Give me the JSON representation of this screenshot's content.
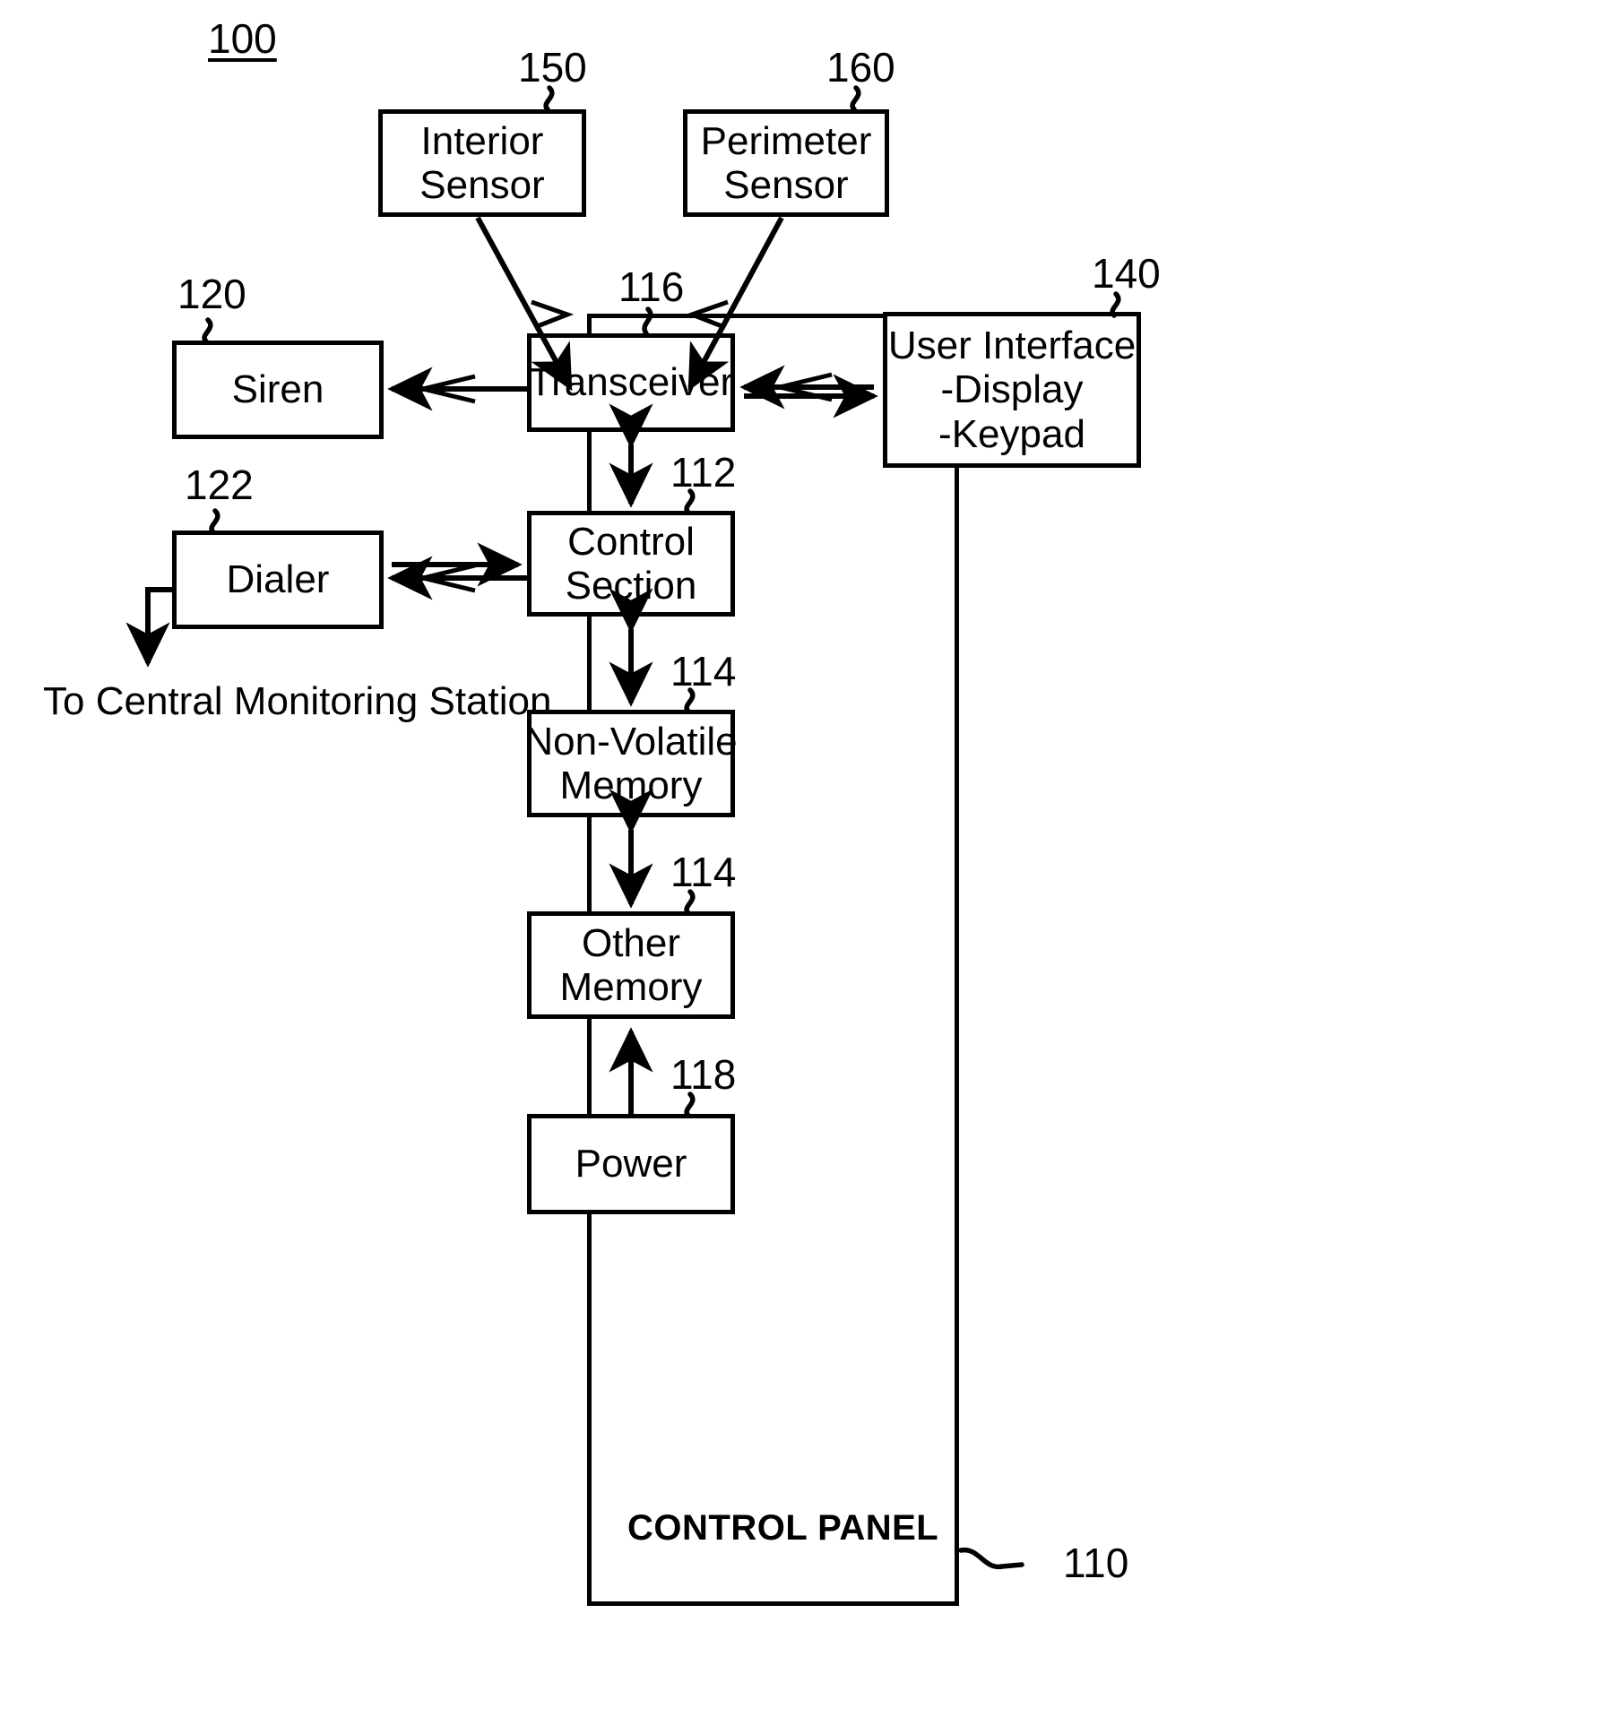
{
  "figure": {
    "number": "100"
  },
  "blocks": {
    "interior_sensor": {
      "lines": [
        "Interior",
        "Sensor"
      ],
      "ref": "150"
    },
    "perimeter_sensor": {
      "lines": [
        "Perimeter",
        "Sensor"
      ],
      "ref": "160"
    },
    "siren": {
      "lines": [
        "Siren"
      ],
      "ref": "120"
    },
    "dialer": {
      "lines": [
        "Dialer"
      ],
      "ref": "122"
    },
    "user_interface": {
      "lines": [
        "User Interface",
        "-Display",
        "-Keypad"
      ],
      "ref": "140"
    },
    "transceiver": {
      "lines": [
        "Transceiver"
      ],
      "ref": "116"
    },
    "control_section": {
      "lines": [
        "Control",
        "Section"
      ],
      "ref": "112"
    },
    "non_volatile_memory": {
      "lines": [
        "Non-Volatile",
        "Memory"
      ],
      "ref": "114"
    },
    "other_memory": {
      "lines": [
        "Other",
        "Memory"
      ],
      "ref": "114"
    },
    "power": {
      "lines": [
        "Power"
      ],
      "ref": "118"
    }
  },
  "control_panel": {
    "title": "CONTROL PANEL",
    "ref": "110"
  },
  "annotations": {
    "central_station": [
      "To",
      "Central",
      "Monitoring",
      "Station"
    ]
  },
  "colors": {
    "line": "#000000",
    "background": "#ffffff"
  }
}
